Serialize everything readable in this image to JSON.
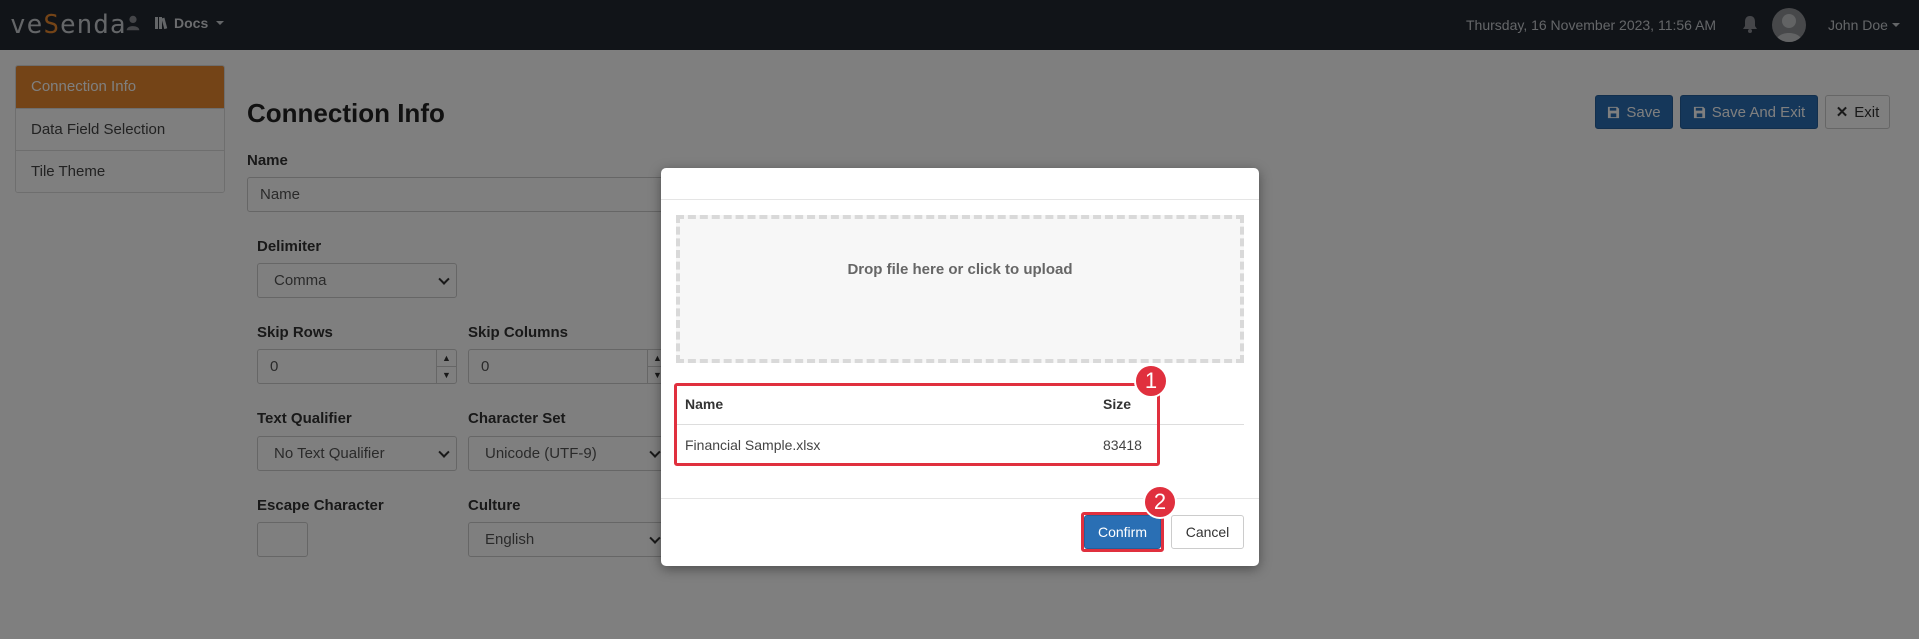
{
  "navbar": {
    "logo_prefix": "ve",
    "logo_accent": "S",
    "logo_suffix": "enda",
    "docs_label": "Docs",
    "datetime": "Thursday, 16 November 2023, 11:56 AM",
    "username": "John Doe"
  },
  "sidebar": {
    "items": [
      {
        "label": "Connection Info",
        "active": true
      },
      {
        "label": "Data Field Selection",
        "active": false
      },
      {
        "label": "Tile Theme",
        "active": false
      }
    ]
  },
  "main": {
    "title": "Connection Info",
    "buttons": {
      "save": "Save",
      "save_and_exit": "Save And Exit",
      "exit": "Exit"
    },
    "form": {
      "name_label": "Name",
      "name_placeholder": "Name",
      "delimiter_label": "Delimiter",
      "delimiter_value": "Comma",
      "skip_rows_label": "Skip Rows",
      "skip_rows_value": "0",
      "skip_columns_label": "Skip Columns",
      "skip_columns_value": "0",
      "text_qualifier_label": "Text Qualifier",
      "text_qualifier_value": "No Text Qualifier",
      "character_set_label": "Character Set",
      "character_set_value": "Unicode (UTF-9)",
      "escape_character_label": "Escape Character",
      "escape_character_value": "",
      "culture_label": "Culture",
      "culture_value": "English"
    }
  },
  "modal": {
    "dropzone_text": "Drop file here or click to upload",
    "table": {
      "headers": {
        "name": "Name",
        "size": "Size"
      },
      "rows": [
        {
          "name": "Financial Sample.xlsx",
          "size": "83418"
        }
      ]
    },
    "confirm_label": "Confirm",
    "cancel_label": "Cancel"
  },
  "annotations": {
    "badge_1": "1",
    "badge_2": "2",
    "color": "#e0303e"
  },
  "colors": {
    "navbar_bg": "#222831",
    "accent_orange": "#e8892f",
    "primary_blue": "#2a6fb4"
  }
}
